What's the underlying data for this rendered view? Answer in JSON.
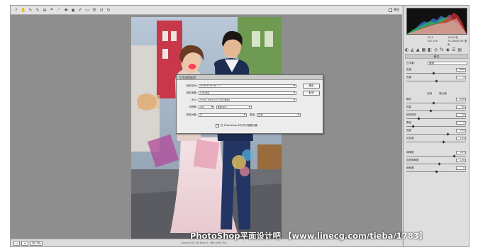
{
  "toolbar": {
    "tools": [
      "zoom-icon",
      "hand-icon",
      "white-balance-icon",
      "color-sampler-icon",
      "target-adjust-icon",
      "crop-icon",
      "straighten-icon",
      "spot-removal-icon",
      "red-eye-icon",
      "adjustment-brush-icon",
      "graduated-filter-icon",
      "preferences-icon",
      "rotate-left-icon",
      "rotate-right-icon"
    ],
    "preview_label": "预览"
  },
  "histogram_meta": {
    "r": "R:",
    "g": "G:",
    "b": "B:",
    "aperture": "f/3.5",
    "shutter": "1/200 秒",
    "iso": "ISO 100",
    "lens": "70-200@135 毫米"
  },
  "panel": {
    "title": "基本",
    "white_balance_label": "白平衡:",
    "white_balance_value": "原照",
    "auto_label": "自动",
    "default_label": "默认值",
    "sliders": [
      {
        "label": "色温",
        "value": "4800",
        "pos": 0.45
      },
      {
        "label": "色调",
        "value": "-1",
        "pos": 0.5
      },
      {
        "label": "曝光",
        "value": "-0.50",
        "pos": 0.45
      },
      {
        "label": "恢复",
        "value": "40",
        "pos": 0.4
      },
      {
        "label": "填充亮光",
        "value": "18",
        "pos": 0.2
      },
      {
        "label": "黑色",
        "value": "5",
        "pos": 0.1
      },
      {
        "label": "亮度",
        "value": "+63",
        "pos": 0.7
      },
      {
        "label": "对比度",
        "value": "+34",
        "pos": 0.62
      },
      {
        "label": "清晰度",
        "value": "+61",
        "pos": 0.8
      },
      {
        "label": "自然饱和度",
        "value": "+10",
        "pos": 0.55
      },
      {
        "label": "饱和度",
        "value": "0",
        "pos": 0.5
      }
    ]
  },
  "dialog": {
    "title": "工作流程选项",
    "space_label": "色彩空间:",
    "space_value": "sRGB IEC61966-2.1",
    "depth_label": "色彩深度:",
    "depth_value": "8 位/通道",
    "size_label": "大小:",
    "size_value": "3744 x 5616 (21.0 百万像素)",
    "res_label": "分辨率:",
    "res_value": "240",
    "res_unit": "像素/英寸",
    "sharpen_label": "锐化对象:",
    "sharpen_value": "无",
    "amount_label": "数量:",
    "amount_value": "标准",
    "ok_label": "确定",
    "cancel_label": "取消",
    "smart_label": "在 Photoshop 中打开为智能对象"
  },
  "statusbar": {
    "zoom_value": "16.7%",
    "info_text": "Canon EOS 5D Mark II; 380.0000 ISO"
  },
  "watermark": "PhotoShop平面设计吧 【www.linecg.com/tieba/1783】"
}
